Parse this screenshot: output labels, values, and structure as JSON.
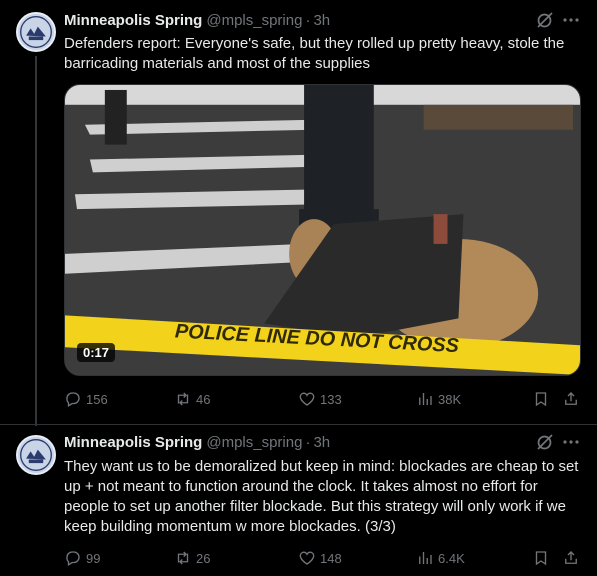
{
  "tweets": [
    {
      "name": "Minneapolis Spring",
      "handle": "@mpls_spring",
      "separator": "·",
      "time": "3h",
      "text": "Defenders report: Everyone's safe, but they rolled up pretty heavy, stole the barricading materials and most of the supplies",
      "media": {
        "duration": "0:17",
        "tape_text": "POLICE LINE DO NOT CROSS"
      },
      "stats": {
        "replies": "156",
        "retweets": "46",
        "likes": "133",
        "views": "38K"
      }
    },
    {
      "name": "Minneapolis Spring",
      "handle": "@mpls_spring",
      "separator": "·",
      "time": "3h",
      "text": "They want us to be demoralized but keep in mind: blockades are cheap to set up + not meant to function around the clock. It takes almost no effort for people to set up another filter blockade. But this strategy will only work if we keep building momentum w more blockades. (3/3)",
      "stats": {
        "replies": "99",
        "retweets": "26",
        "likes": "148",
        "views": "6.4K"
      }
    }
  ],
  "colors": {
    "background": "#000000",
    "text": "#e7e9ea",
    "secondary": "#71767b",
    "divider": "#2f3336",
    "tape": "#f2d21b"
  },
  "icons": [
    "avatar",
    "grok-icon",
    "more-icon",
    "reply-icon",
    "retweet-icon",
    "like-icon",
    "views-icon",
    "bookmark-icon",
    "share-icon"
  ]
}
